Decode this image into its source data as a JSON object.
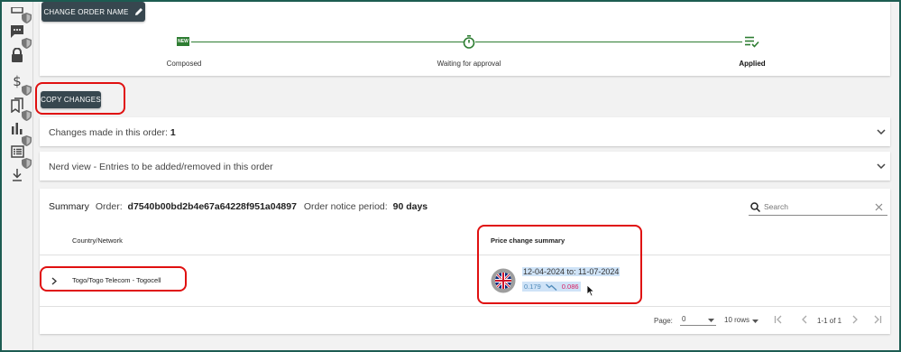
{
  "toolbar": {
    "change_order_name_label": "CHANGE ORDER NAME",
    "copy_changes_label": "COPY CHANGES"
  },
  "stepper": {
    "steps": [
      {
        "label": "Composed",
        "icon": "new-badge-icon",
        "badge": "NEW"
      },
      {
        "label": "Waiting for approval",
        "icon": "stopwatch-icon"
      },
      {
        "label": "Applied",
        "icon": "list-check-icon"
      }
    ],
    "accent": "#2e7d32"
  },
  "accordions": {
    "changes_label": "Changes made in this order: ",
    "changes_count": "1",
    "nerd_view_label": "Nerd view - Entries to be added/removed in this order"
  },
  "summary": {
    "title": "Summary",
    "order_label": "Order:",
    "order_id": "d7540b00bd2b4e67a64228f951a04897",
    "notice_label": "Order notice period:",
    "notice_value": "90 days",
    "search_placeholder": "Search",
    "columns": [
      "Country/Network",
      "Price change summary"
    ],
    "rows": [
      {
        "network": "Togo/Togo Telecom - Togocell",
        "date_range": "12-04-2024 to: 11-07-2024",
        "old_price": "0.179",
        "new_price": "0.086"
      }
    ]
  },
  "pagination": {
    "page_label": "Page:",
    "page_value": "0",
    "rows_value": "10 rows",
    "range_text": "1-1 of 1"
  },
  "colors": {
    "highlight": "#cfe3f7",
    "annotation_red": "#e01010",
    "button_dark": "#37474f",
    "price_down": "#d81b60"
  }
}
